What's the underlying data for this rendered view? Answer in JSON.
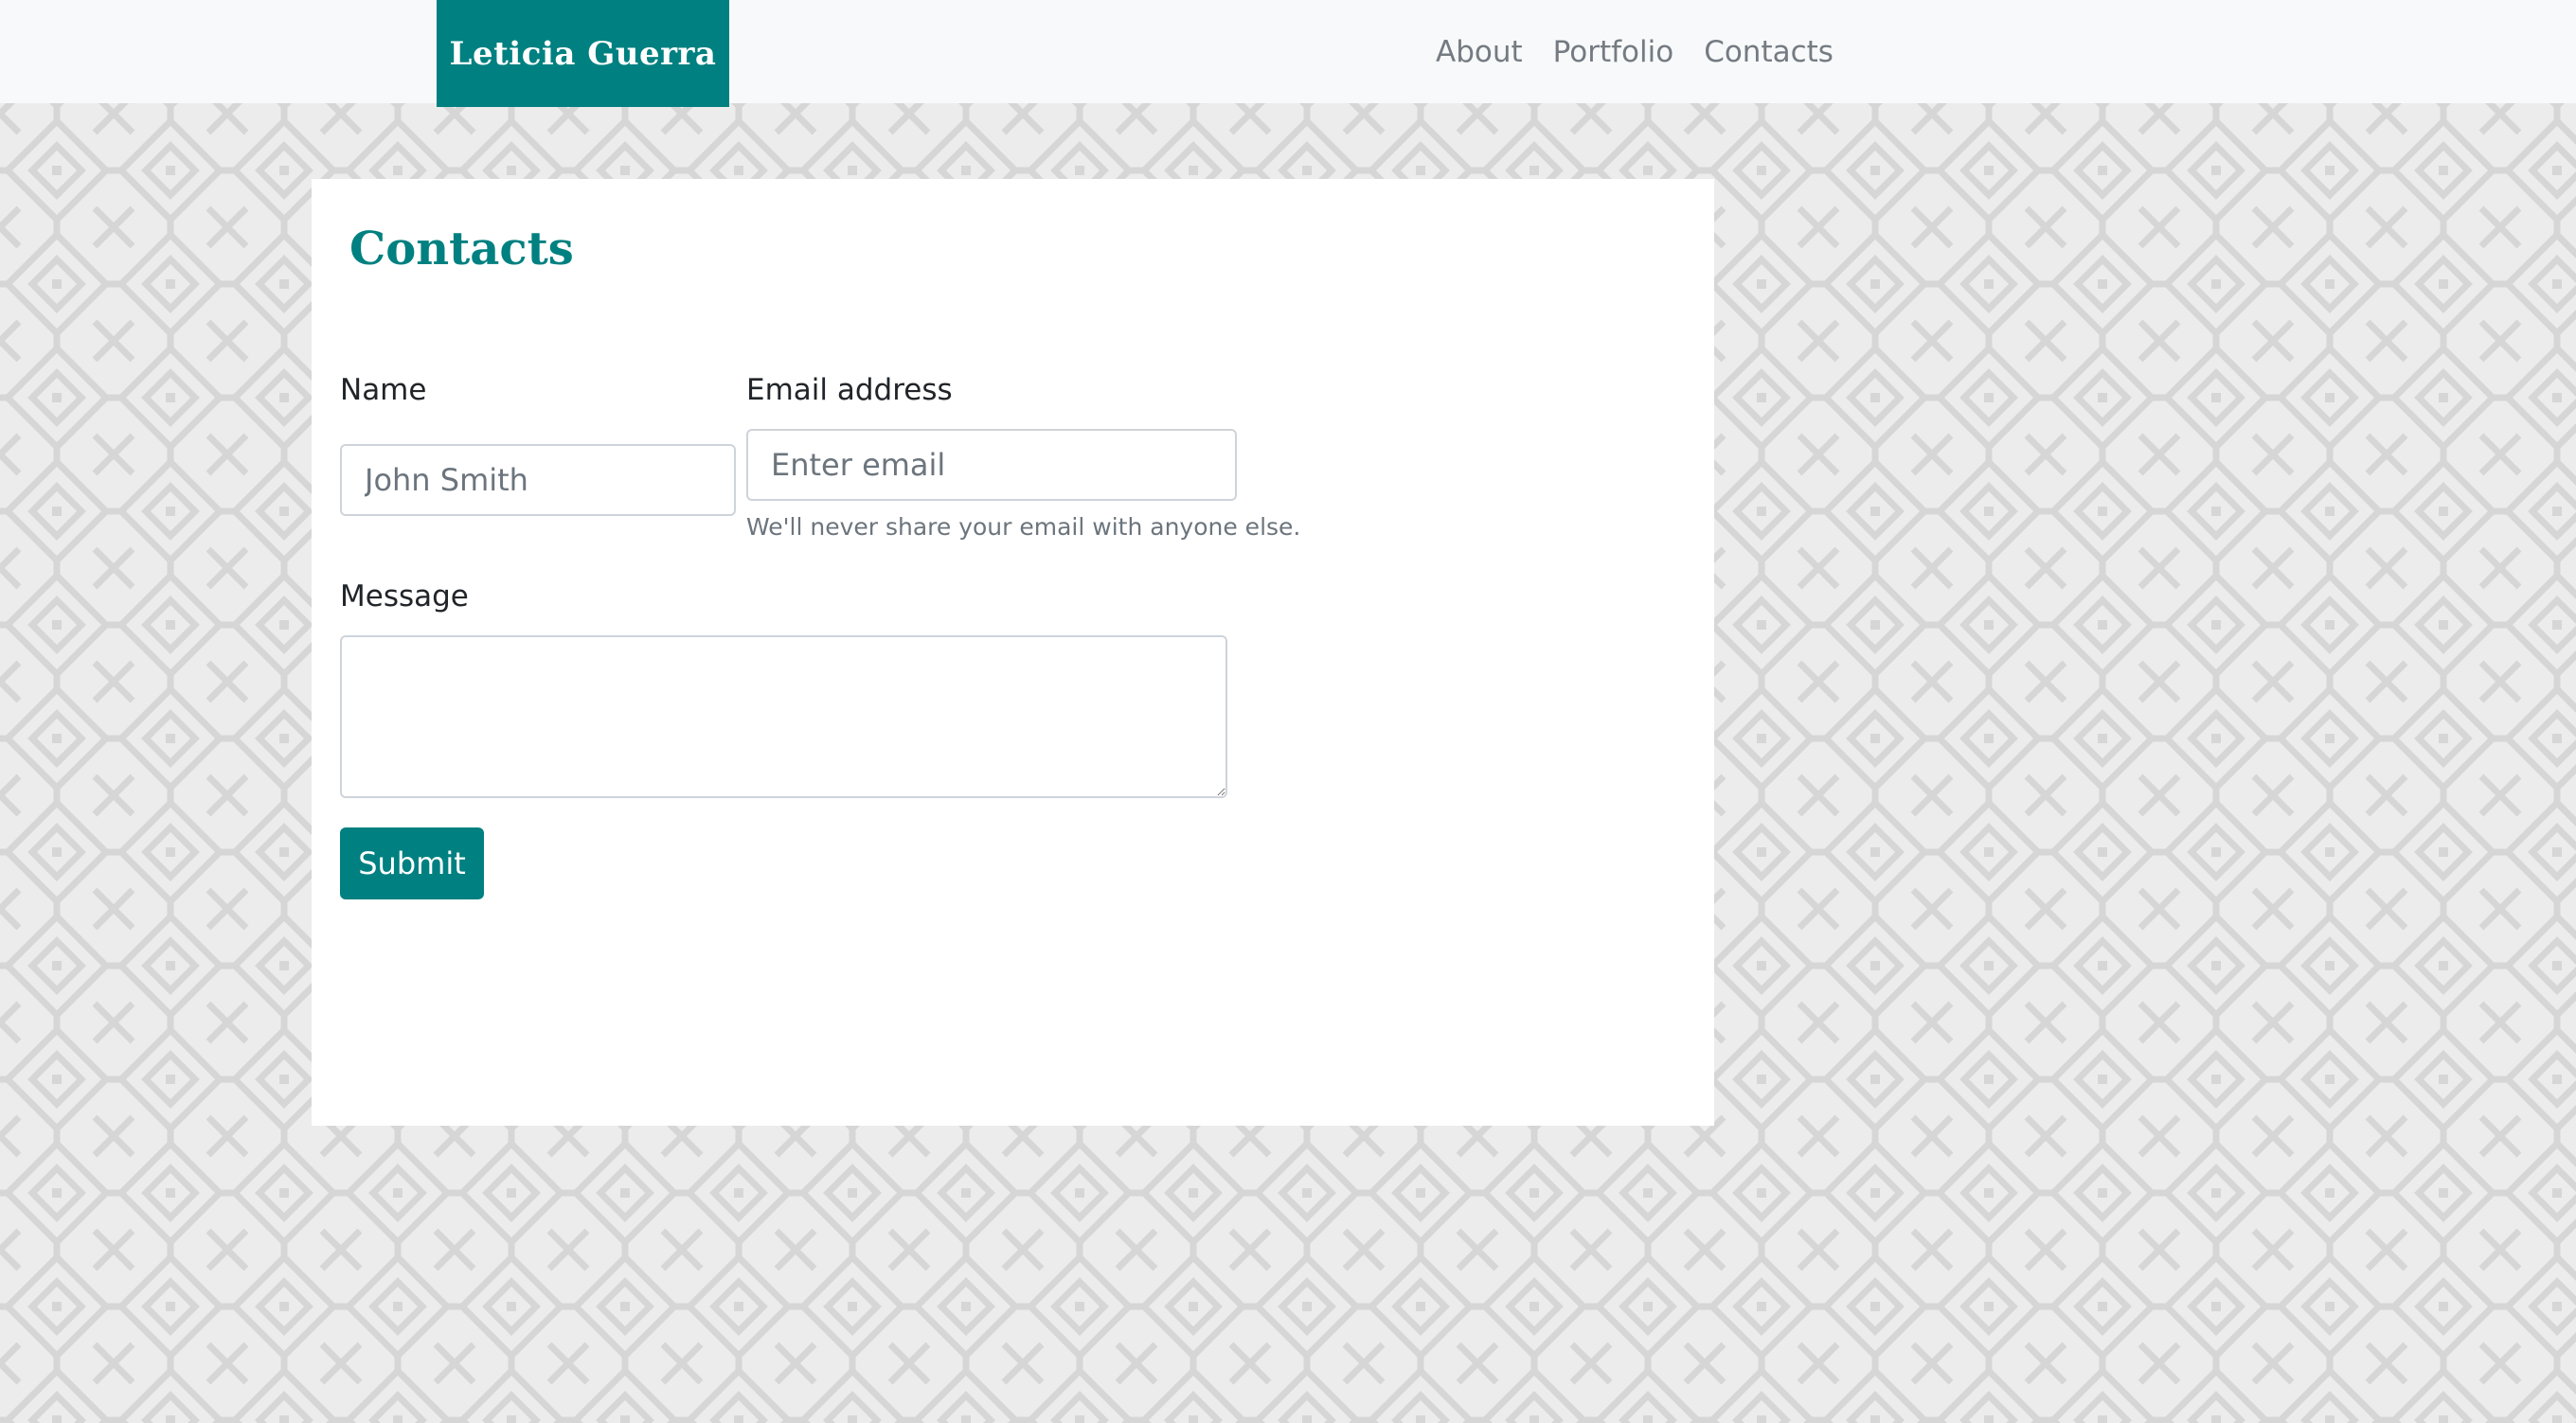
{
  "brand": {
    "name": "Leticia Guerra"
  },
  "nav": {
    "links": [
      {
        "label": "About"
      },
      {
        "label": "Portfolio"
      },
      {
        "label": "Contacts"
      }
    ]
  },
  "contacts": {
    "title": "Contacts",
    "form": {
      "name": {
        "label": "Name",
        "placeholder": "John Smith",
        "value": ""
      },
      "email": {
        "label": "Email address",
        "placeholder": "Enter email",
        "value": "",
        "help": "We'll never share your email with anyone else."
      },
      "message": {
        "label": "Message",
        "value": ""
      },
      "submit_label": "Submit"
    }
  },
  "colors": {
    "brand": "#008080",
    "navbar_bg": "#f8f9fa",
    "page_bg": "#ececec",
    "pattern": "#d9d9d9"
  }
}
